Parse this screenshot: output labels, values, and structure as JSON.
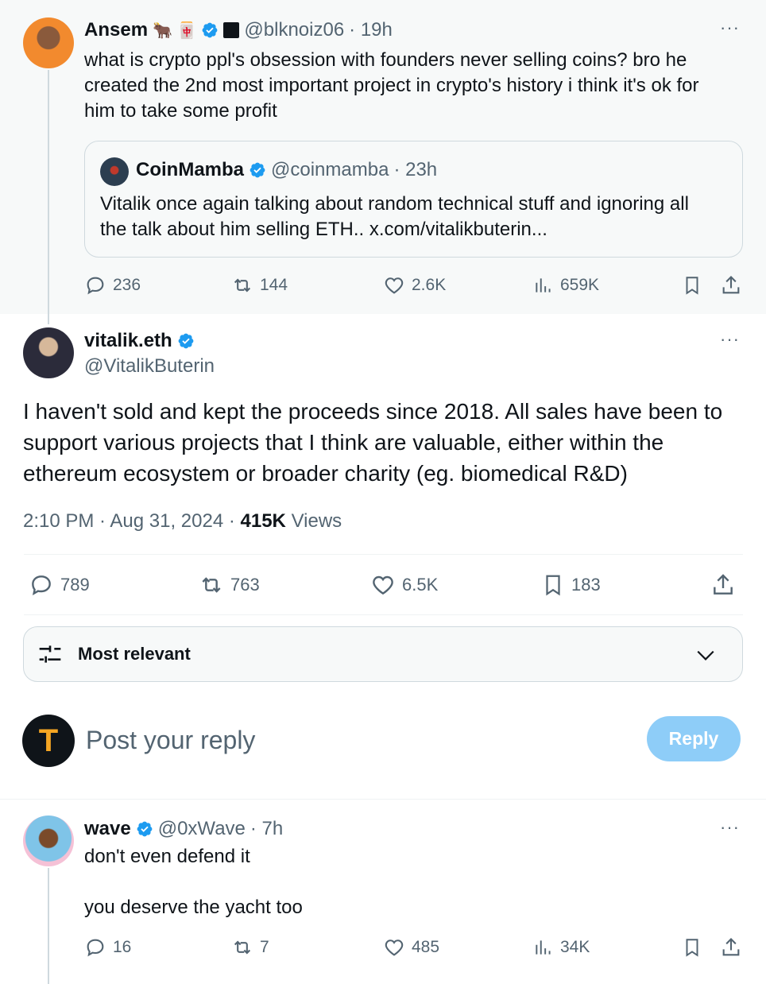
{
  "parent_tweet": {
    "author_name": "Ansem",
    "author_emoji": "🐂 🀄",
    "handle": "@blknoiz06",
    "time": "· 19h",
    "text_lines": [
      "what is crypto ppl's obsession with founders never selling coins? bro he",
      "created the 2nd most important project in crypto's history i think it's ok for",
      "him to take some profit"
    ],
    "quote": {
      "author_name": "CoinMamba",
      "handle": "@coinmamba",
      "time": "· 23h",
      "text_lines": [
        "Vitalik once again talking about random technical stuff and ignoring all",
        "the talk about him selling ETH.. x.com/vitalikbuterin..."
      ]
    },
    "stats": {
      "replies": "236",
      "reposts": "144",
      "likes": "2.6K",
      "views": "659K"
    }
  },
  "main_tweet": {
    "author_name": "vitalik.eth",
    "handle": "@VitalikButerin",
    "text_lines": [
      "I haven't sold and kept the proceeds since 2018. All sales have been to",
      "support various projects that I think are valuable, either within the",
      "ethereum ecosystem or broader charity (eg. biomedical R&D)"
    ],
    "timestamp": "2:10 PM · Aug 31, 2024 ·",
    "views_count": "415K",
    "views_label": "Views",
    "stats": {
      "replies": "789",
      "reposts": "763",
      "likes": "6.5K",
      "bookmarks": "183"
    }
  },
  "sort_bar": {
    "label": "Most relevant"
  },
  "reply_composer": {
    "placeholder": "Post your reply",
    "button": "Reply",
    "avatar_letter": "T"
  },
  "reply_tweet": {
    "author_name": "wave",
    "handle": "@0xWave",
    "time": "· 7h",
    "text_lines": [
      "don't even defend it",
      "",
      "you deserve the yacht too"
    ],
    "stats": {
      "replies": "16",
      "reposts": "7",
      "likes": "485",
      "views": "34K"
    }
  },
  "colors": {
    "accent": "#1d9bf0",
    "reply_button_disabled": "#8ecdf8",
    "text_gray": "#536471",
    "quote_bg": "#f7f9f9"
  }
}
